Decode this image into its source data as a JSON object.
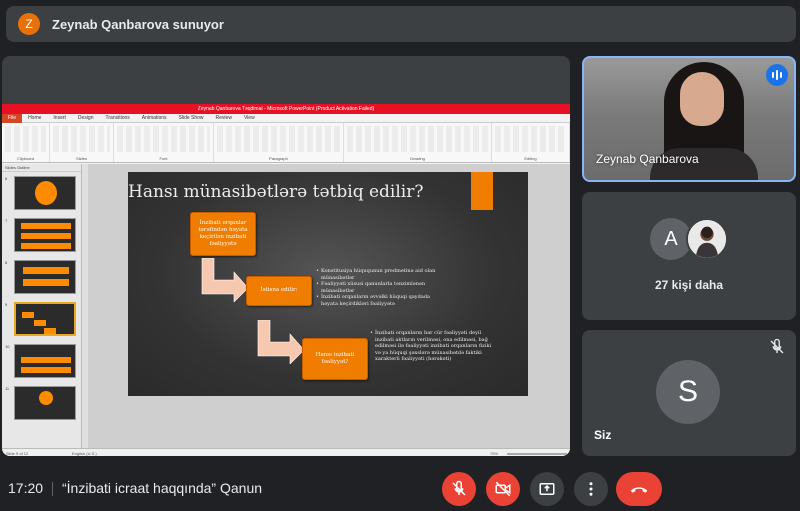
{
  "banner": {
    "avatar_letter": "Z",
    "text": "Zeynab Qanbarova sunuyor"
  },
  "ppt": {
    "window_title": "Zeynab Qanbarova Təqdimat - Microsoft PowerPoint (Product Activation Failed)",
    "tabs": [
      "File",
      "Home",
      "Insert",
      "Design",
      "Transitions",
      "Animations",
      "Slide Show",
      "Review",
      "View"
    ],
    "ribbon_groups": [
      "Clipboard",
      "Slides",
      "Font",
      "Paragraph",
      "Drawing",
      "Editing"
    ],
    "panel_tabs": "Slides   Outline",
    "thumb_numbers": [
      "6",
      "7",
      "8",
      "9",
      "10",
      "11"
    ],
    "status_left": "Slide 9 of 12",
    "status_lang": "English (U.S.)",
    "zoom": "75%",
    "slide": {
      "title": "Hansı münasibətlərə tətbiq edilir?",
      "box1": "İnzibati orqanlar tərəfindən həyata keçirilən inzibati fəaliyyətə",
      "box2": "İstisna edilir:",
      "box3": "Hansı inzibati fəaliyyət?",
      "bullets1": [
        "Konstitusiya hüququnun predmetinə aid olan münasibətlər",
        "Fəaliyyəti xüsusi qanunlarla tənzimlənən münasibətlər",
        "İnzibati orqanların əvvəlki hüquqi qaydada həyata keçirdikləri fəaliyyətə"
      ],
      "bullets2": [
        "İnzibati orqanların hər cür fəaliyyəti deyil inzibati aktların verilməsi, ona edilməsi, bağ edilməsi ilə fəaliyyəti inzibati orqanların fiziki və ya hüquqi şəxslərə münasibətdə faktiki xarakterli fəaliyyəti (hərəkəti)"
      ]
    }
  },
  "tiles": {
    "presenter_name": "Zeynab Qanbarova",
    "others_letter": "A",
    "others_count": "27 kişi daha",
    "self_letter": "S",
    "self_name": "Siz"
  },
  "bottom": {
    "time": "17:20",
    "meeting_title": "“İnzibati icraat haqqında” Qanun"
  },
  "colors": {
    "accent": "#8ab4f8",
    "danger": "#ea4335",
    "orange": "#f07c00",
    "speaking": "#1a73e8"
  },
  "icons": [
    "mic-off-icon",
    "camera-off-icon",
    "present-icon",
    "more-vert-icon",
    "call-end-icon",
    "mute-icon",
    "speaking-icon"
  ]
}
